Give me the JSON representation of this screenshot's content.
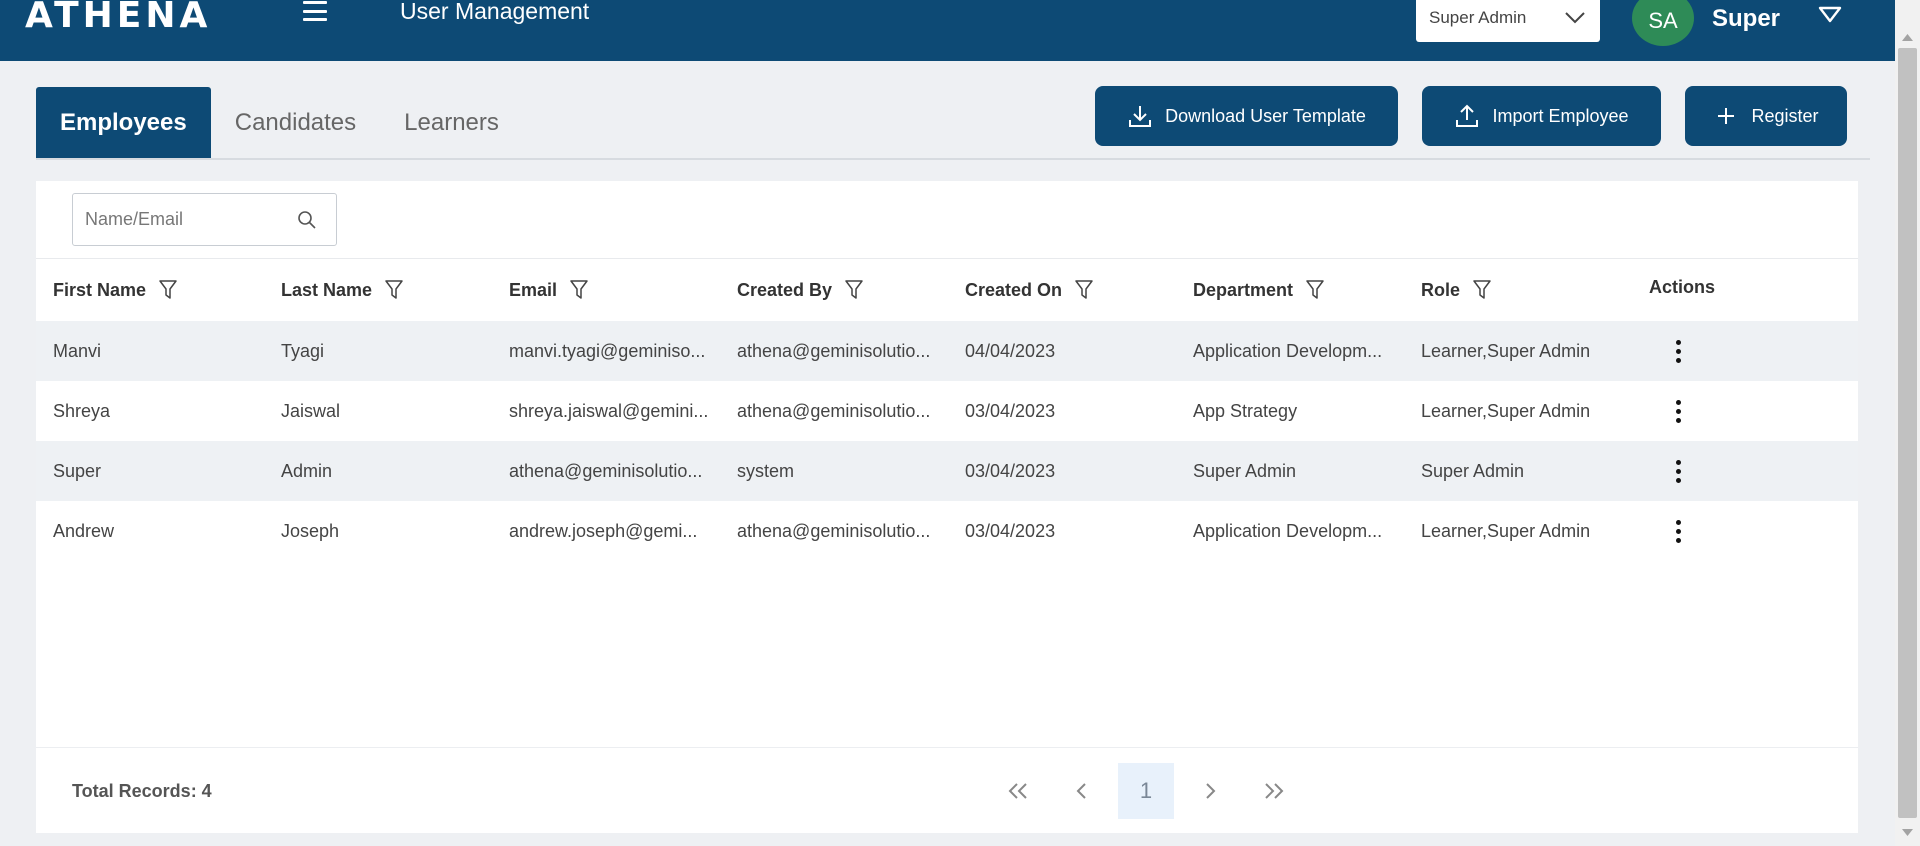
{
  "header": {
    "logo_text": "ATHENA",
    "title": "User Management",
    "role_select": {
      "value": "Super Admin"
    },
    "avatar_initials": "SA",
    "user_name": "Super"
  },
  "tabs": [
    {
      "label": "Employees",
      "active": true
    },
    {
      "label": "Candidates",
      "active": false
    },
    {
      "label": "Learners",
      "active": false
    }
  ],
  "actions": {
    "download_label": "Download User Template",
    "import_label": "Import Employee",
    "register_label": "Register"
  },
  "search": {
    "placeholder": "Name/Email",
    "value": ""
  },
  "table": {
    "columns": [
      "First Name",
      "Last Name",
      "Email",
      "Created By",
      "Created On",
      "Department",
      "Role",
      "Actions"
    ],
    "rows": [
      [
        "Manvi",
        "Tyagi",
        "manvi.tyagi@geminiso...",
        "athena@geminisolutio...",
        "04/04/2023",
        "Application Developm...",
        "Learner,Super Admin"
      ],
      [
        "Shreya",
        "Jaiswal",
        "shreya.jaiswal@gemini...",
        "athena@geminisolutio...",
        "03/04/2023",
        "App Strategy",
        "Learner,Super Admin"
      ],
      [
        "Super",
        "Admin",
        "athena@geminisolutio...",
        "system",
        "03/04/2023",
        "Super Admin",
        "Super Admin"
      ],
      [
        "Andrew",
        "Joseph",
        "andrew.joseph@gemi...",
        "athena@geminisolutio...",
        "03/04/2023",
        "Application Developm...",
        "Learner,Super Admin"
      ]
    ]
  },
  "footer": {
    "total_records": "Total Records: 4",
    "current_page": "1"
  },
  "colors": {
    "brand": "#0d4a75",
    "avatar": "#2e8b57",
    "row_alt": "#eef1f4"
  }
}
